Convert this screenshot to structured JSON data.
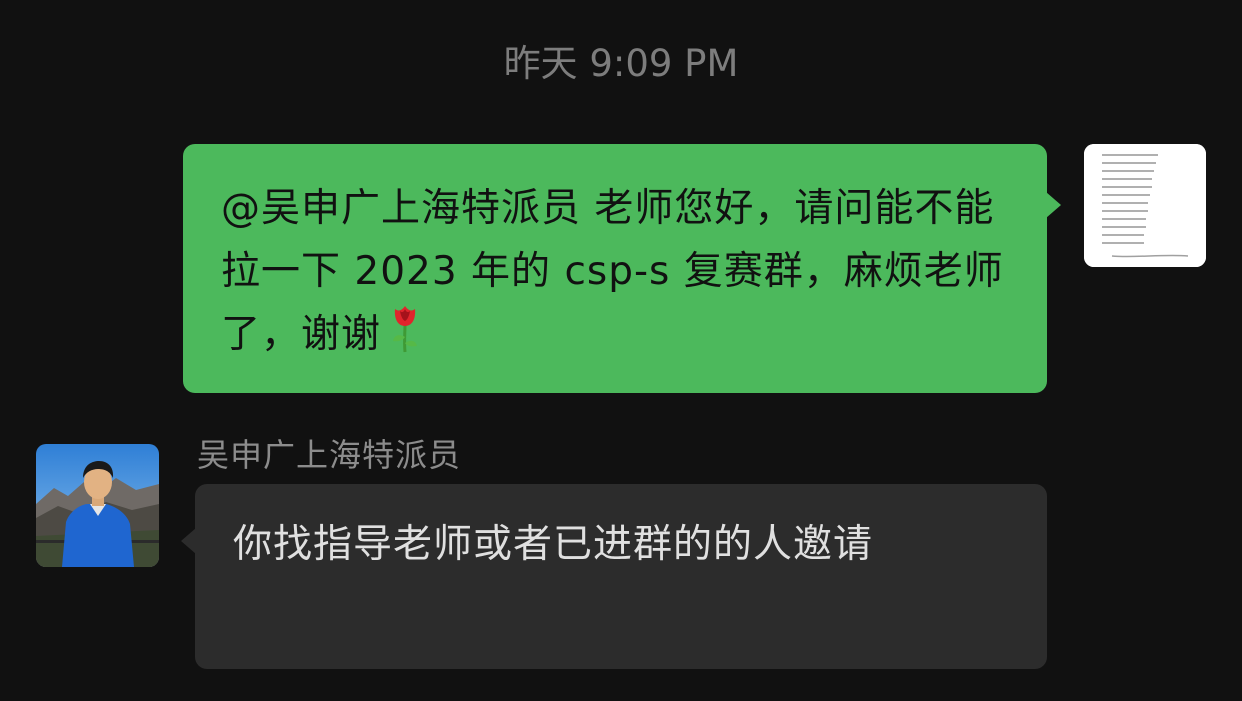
{
  "chat": {
    "timestamp": "昨天 9:09 PM",
    "messages": [
      {
        "direction": "outgoing",
        "text": "@吴申广上海特派员 老师您好，请问能不能拉一下 2023 年的 csp-s 复赛群，麻烦老师了，谢谢",
        "emoji": "rose-emoji",
        "bubble_color": "#4cb95c"
      },
      {
        "direction": "incoming",
        "sender": "吴申广上海特派员",
        "text": "你找指导老师或者已进群的的人邀请",
        "bubble_color": "#2c2c2c"
      }
    ]
  },
  "theme": {
    "background": "#111111",
    "timestamp_color": "#7d7d7d",
    "sender_name_color": "#8c8c8c"
  }
}
